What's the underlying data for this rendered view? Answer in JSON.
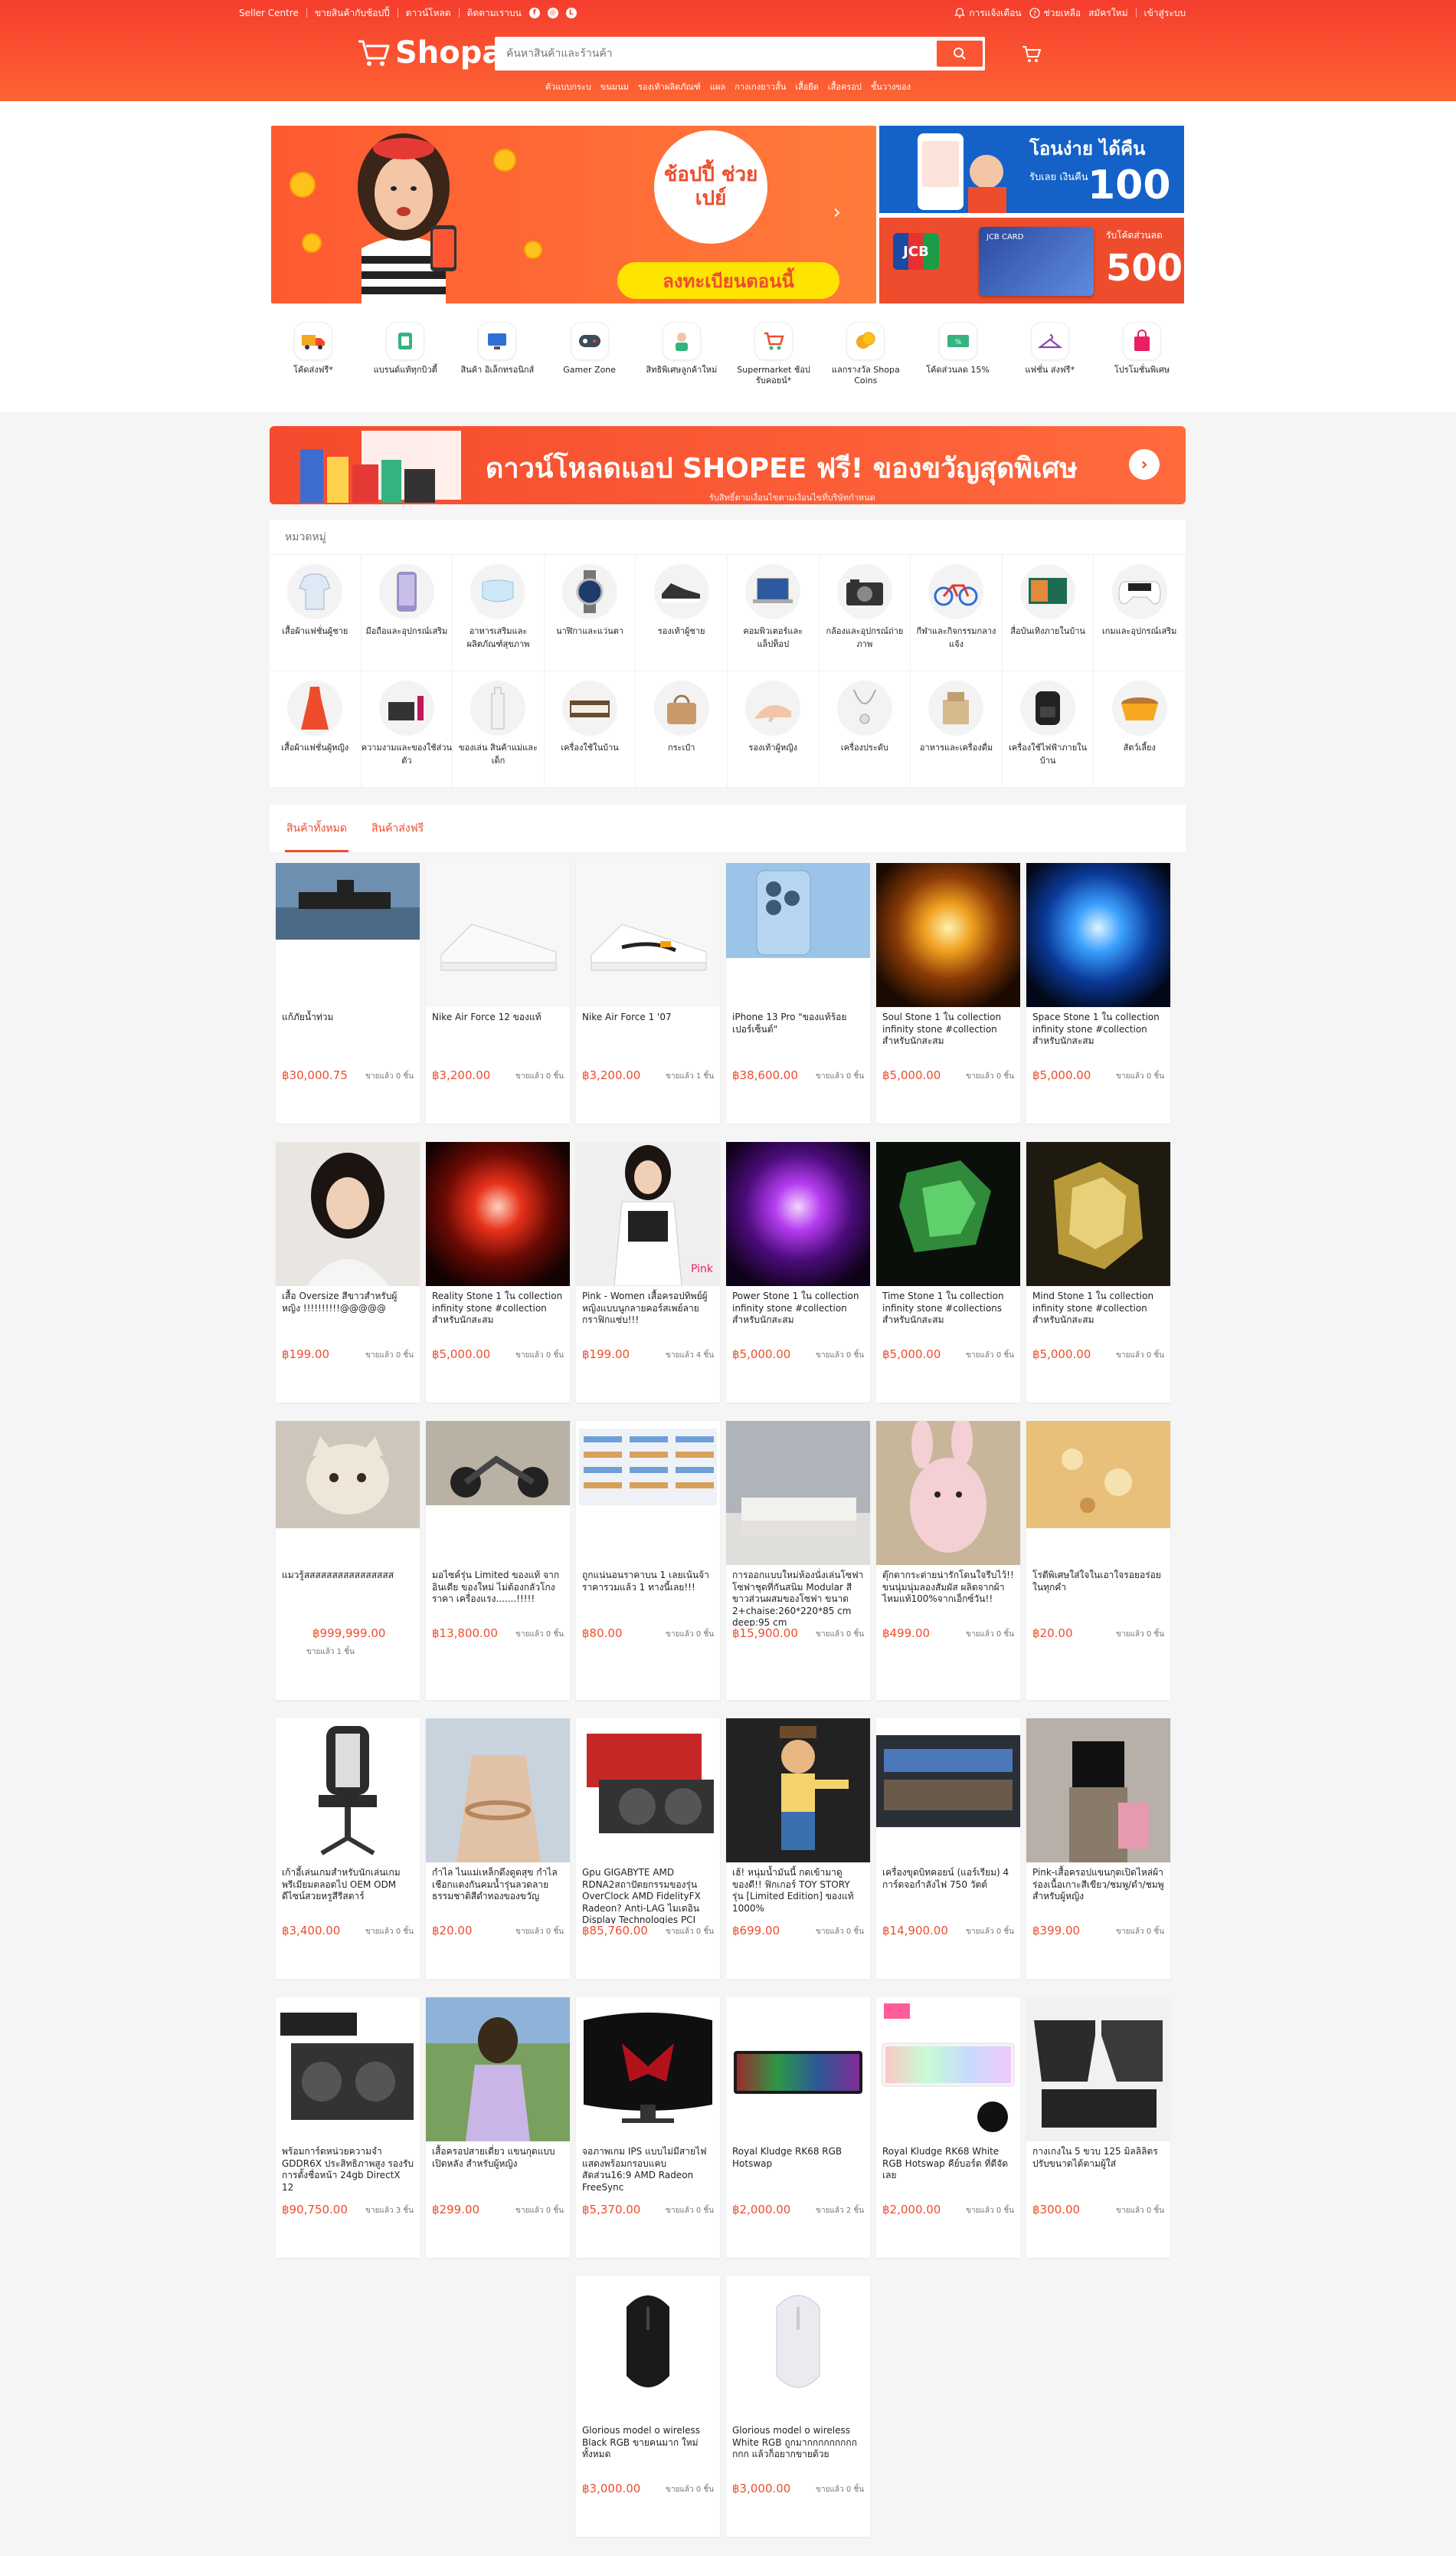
{
  "topbar": {
    "left": [
      "Seller Centre",
      "ขายสินค้ากับช้อปปี้",
      "ดาวน์โหลด",
      "ติดตามเราบน"
    ],
    "right": [
      "การแจ้งเตือน",
      "ช่วยเหลือ",
      "สมัครใหม่",
      "เข้าสู่ระบบ"
    ]
  },
  "header": {
    "logo": "Shopa",
    "search_placeholder": "ค้นหาสินค้าและร้านค้า",
    "suggestions": [
      "ตัวแบบกระบ",
      "ขนมนม",
      "รองเท้าผลิตภัณฑ์",
      "แผล",
      "กางเกงยาวสั้น",
      "เสื้อยืด",
      "เสื้อครอป",
      "ชั้นวางของ"
    ]
  },
  "banners": {
    "main_text": "ช้อปปี้ ช่วยเปย์",
    "main_cta": "ลงทะเบียนตอนนี้",
    "side1_line1": "โอนง่าย ได้คืน",
    "side1_line2": "รับเลย เงินคืน",
    "side1_num": "100",
    "side2_brand": "JCB",
    "side2_card": "JCB CARD",
    "side2_label": "รับโค้ดส่วนลด",
    "side2_num": "500"
  },
  "quick_cats": [
    "โค้ดส่งฟรี*",
    "แบรนด์แท้ทุกบิวตี้",
    "สินค้า อิเล็กทรอนิกส์",
    "Gamer Zone",
    "สิทธิพิเศษลูกค้าใหม่",
    "Supermarket ช้อป รับคอยน์*",
    "แลกรางวัล Shopa Coins",
    "โค้ดส่วนลด 15%",
    "แฟชั่น ส่งฟรี*",
    "โปรโมชั่นพิเศษ"
  ],
  "app_banner": {
    "text": "ดาวน์โหลดแอป SHOPEE ฟรี! ของขวัญสุดพิเศษ",
    "sub": "รับสิทธิ์ตามเงื่อนไขตามเงื่อนไขที่บริษัทกำหนด"
  },
  "categories": {
    "title": "หมวดหมู่",
    "items": [
      "เสื้อผ้าแฟชั่นผู้ชาย",
      "มือถือและอุปกรณ์เสริม",
      "อาหารเสริมและผลิตภัณฑ์สุขภาพ",
      "นาฬิกาและแว่นตา",
      "รองเท้าผู้ชาย",
      "คอมพิวเตอร์และแล็ปท็อป",
      "กล้องและอุปกรณ์ถ่ายภาพ",
      "กีฬาและกิจกรรมกลางแจ้ง",
      "สื่อบันเทิงภายในบ้าน",
      "เกมและอุปกรณ์เสริม",
      "เสื้อผ้าแฟชั่นผู้หญิง",
      "ความงามและของใช้ส่วนตัว",
      "ของเล่น สินค้าแม่และเด็ก",
      "เครื่องใช้ในบ้าน",
      "กระเป๋า",
      "รองเท้าผู้หญิง",
      "เครื่องประดับ",
      "อาหารและเครื่องดื่ม",
      "เครื่องใช้ไฟฟ้าภายในบ้าน",
      "สัตว์เลี้ยง"
    ]
  },
  "tabs": [
    "สินค้าทั้งหมด",
    "สินค้าส่งฟรี"
  ],
  "products": [
    {
      "name": "แก้ภัยน้ำท่วม",
      "price": "฿30,000.75",
      "sold": "ขายแล้ว 0 ชิ้น"
    },
    {
      "name": "Nike Air Force 12 ของแท้",
      "price": "฿3,200.00",
      "sold": "ขายแล้ว 0 ชิ้น"
    },
    {
      "name": "Nike Air Force 1 '07",
      "price": "฿3,200.00",
      "sold": "ขายแล้ว 1 ชิ้น"
    },
    {
      "name": "iPhone 13 Pro \"ของแท้ร้อยเปอร์เซ็นต์\"",
      "price": "฿38,600.00",
      "sold": "ขายแล้ว 0 ชิ้น"
    },
    {
      "name": "Soul Stone 1 ใน collection infinity stone #collection สำหรับนักสะสม",
      "price": "฿5,000.00",
      "sold": "ขายแล้ว 0 ชิ้น"
    },
    {
      "name": "Space Stone 1 ใน collection infinity stone #collection สำหรับนักสะสม",
      "price": "฿5,000.00",
      "sold": "ขายแล้ว 0 ชิ้น"
    },
    {
      "name": "เสื้อ Oversize สีขาวสำหรับผู้หญิง !!!!!!!!!!@@@@@",
      "price": "฿199.00",
      "sold": "ขายแล้ว 0 ชิ้น"
    },
    {
      "name": "Reality Stone 1 ใน collection infinity stone #collection สำหรับนักสะสม",
      "price": "฿5,000.00",
      "sold": "ขายแล้ว 0 ชิ้น"
    },
    {
      "name": "Pink - Women เสื้อครอปทิพย์ผู้หญิงแบบนูกลายคอร์สเพย์ลายกราฟิกแซ่บ!!!",
      "price": "฿199.00",
      "sold": "ขายแล้ว 4 ชิ้น"
    },
    {
      "name": "Power Stone 1 ใน collection infinity stone #collection สำหรับนักสะสม",
      "price": "฿5,000.00",
      "sold": "ขายแล้ว 0 ชิ้น"
    },
    {
      "name": "Time Stone 1 ใน collection infinity stone #collections สำหรับนักสะสม",
      "price": "฿5,000.00",
      "sold": "ขายแล้ว 0 ชิ้น"
    },
    {
      "name": "Mind Stone 1 ใน collection infinity stone #collection สำหรับนักสะสม",
      "price": "฿5,000.00",
      "sold": "ขายแล้ว 0 ชิ้น"
    },
    {
      "name": "แมวรู้สสสสสสสสสสสสสสสส",
      "price": "฿999,999.00",
      "sold": "ขายแล้ว 1 ชิ้น"
    },
    {
      "name": "มอไซค์รุ่น Limited ของแท้ จากอินเดีย ของใหม่ ไม่ต้องกลัวโกงราคา เครื่องแรง.......!!!!!",
      "price": "฿13,800.00",
      "sold": "ขายแล้ว 0 ชิ้น"
    },
    {
      "name": "ถูกแน่นอนราคาบน 1 เลยเน้นจ้า ราคารวมแล้ว 1 ทางนี้เลย!!!",
      "price": "฿80.00",
      "sold": "ขายแล้ว 0 ชิ้น"
    },
    {
      "name": "การออกแบบใหม่ห้องนั่งเล่นโซฟาโซฟาชุดที่กันสนิม Modular สีขาวส่วนผสมของโซฟา ขนาด 2+chaise:260*220*85 cm deep:95 cm",
      "price": "฿15,900.00",
      "sold": "ขายแล้ว 0 ชิ้น"
    },
    {
      "name": "ตุ๊กตากระต่ายน่ารักโดนใจรีบไว้!! ขนนุ่มนุ่มลองสัมผัส ผลิตจากผ้าไหมแท้100%จากเอ็กซ์วัน!!",
      "price": "฿499.00",
      "sold": "ขายแล้ว 0 ชิ้น"
    },
    {
      "name": "โรตีพิเศษใส่ใจในเอาใจรอยอร่อยในทุกคำ",
      "price": "฿20.00",
      "sold": "ขายแล้ว 0 ชิ้น"
    },
    {
      "name": "เก้าอี้เล่นเกมสำหรับนักเล่นเกมพรีเมียมตลอดไป OEM ODM ดีไซน์สวยหรูสีรีสตาร์",
      "price": "฿3,400.00",
      "sold": "ขายแล้ว 0 ชิ้น"
    },
    {
      "name": "กำไล ไนแม่เหล็กดึงดูดสุข กำไลเชือกแดงกันคมน้ำรุ่นลวดลายธรรมชาติสีดำทองของขวัญ",
      "price": "฿20.00",
      "sold": "ขายแล้ว 0 ชิ้น"
    },
    {
      "name": "Gpu GIGABYTE AMD RDNA2สถาปัตยกรรมของรุ่น OverClock AMD FidelityFX Radeon? Anti-LAG ไมเดอิน Display Technologies PCI Express",
      "price": "฿85,760.00",
      "sold": "ขายแล้ว 0 ชิ้น"
    },
    {
      "name": "เฮ้! หนุ่มน้ำมันนี้ กดเข้ามาดูของดี!! ฟิกเกอร์ TOY STORY รุ่น [Limited Edition] ของแท้ 1000%",
      "price": "฿699.00",
      "sold": "ขายแล้ว 0 ชิ้น"
    },
    {
      "name": "เครื่องขุดบิทคอยน์ (แอร์เรียม) 4 การ์ดจอกำลังไฟ 750 วัตต์",
      "price": "฿14,900.00",
      "sold": "ขายแล้ว 0 ชิ้น"
    },
    {
      "name": "Pink-เสื้อครอปแขนกุดเปิดไหล่ผ้าร่องเนื้อเกาะสีเขียว/ชมพู/ดำ/ชมพูสำหรับผู้หญิง",
      "price": "฿399.00",
      "sold": "ขายแล้ว 0 ชิ้น"
    },
    {
      "name": "พร้อมการ์ดหน่วยความจำ GDDR6X ประสิทธิภาพสูง รองรับการตั้งชื่อหน้า 24gb DirectX 12",
      "price": "฿90,750.00",
      "sold": "ขายแล้ว 3 ชิ้น"
    },
    {
      "name": "เสื้อครอปสายเดี่ยว แขนกุดแบบเปิดหลัง สำหรับผู้หญิง",
      "price": "฿299.00",
      "sold": "ขายแล้ว 0 ชิ้น"
    },
    {
      "name": "จอภาพเกม IPS แบบไม่มีสายไฟแสดงพร้อมกรอบแคบ สัดส่วน16:9 AMD Radeon FreeSync",
      "price": "฿5,370.00",
      "sold": "ขายแล้ว 0 ชิ้น"
    },
    {
      "name": "Royal Kludge RK68 RGB Hotswap",
      "price": "฿2,000.00",
      "sold": "ขายแล้ว 2 ชิ้น"
    },
    {
      "name": "Royal Kludge RK68 White RGB Hotswap คีย์บอร์ด ที่ดีจัดเลย",
      "price": "฿2,000.00",
      "sold": "ขายแล้ว 0 ชิ้น"
    },
    {
      "name": "กางเกงใน 5 ขวบ 125 มิลลิลิตร ปรับขนาดได้ตามผู้ใส่",
      "price": "฿300.00",
      "sold": "ขายแล้ว 0 ชิ้น"
    },
    {
      "name": "Glorious model o wireless Black RGB ขายคนมาก ใหม่ทั้งหมด",
      "price": "฿3,000.00",
      "sold": "ขายแล้ว 0 ชิ้น"
    },
    {
      "name": "Glorious model o wireless White RGB ถูกมากกกกกกกกกกกก แล้วก็อยากขายด้วย",
      "price": "฿3,000.00",
      "sold": "ขายแล้ว 0 ชิ้น"
    }
  ],
  "colors": {
    "brand": "#ee4d2d",
    "header_top": "#f53d2d",
    "header_bottom": "#fe6433"
  }
}
